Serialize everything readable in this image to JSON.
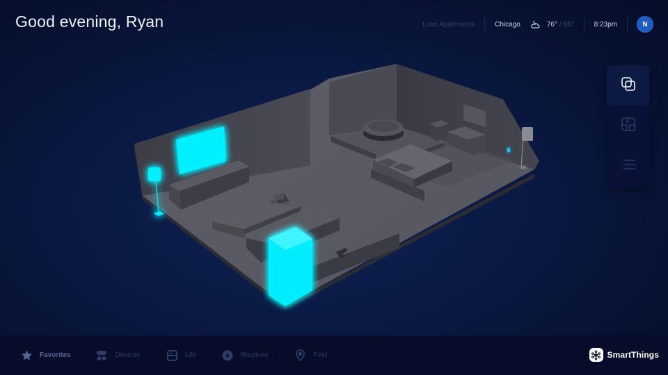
{
  "header": {
    "greeting": "Good evening, Ryan",
    "location": "Luxe Apartments",
    "city": "Chicago",
    "weather_icon": "night-cloud-icon",
    "temp_high": "76°",
    "temp_low": "/ 65°",
    "time": "8:23pm",
    "avatar_initial": "N"
  },
  "view_switcher": {
    "items": [
      {
        "icon": "3d-view-icon",
        "label": "3D view",
        "active": true
      },
      {
        "icon": "floorplan-icon",
        "label": "Floor plan",
        "active": false
      },
      {
        "icon": "list-view-icon",
        "label": "List view",
        "active": false
      }
    ]
  },
  "scene": {
    "rooms": [
      "Living room",
      "Bedroom"
    ],
    "devices_on": [
      "TV",
      "Floor lamp",
      "Air purifier"
    ],
    "devices_standby": [
      "Indicator light"
    ],
    "colors": {
      "glow": "#00f0ff",
      "wall": "#4a4a55",
      "floor": "#5d5d66"
    }
  },
  "bottom_nav": {
    "items": [
      {
        "label": "Favorites",
        "icon": "star-icon",
        "active": true
      },
      {
        "label": "Devices",
        "icon": "devices-icon",
        "active": false
      },
      {
        "label": "Life",
        "icon": "life-icon",
        "active": false
      },
      {
        "label": "Routines",
        "icon": "play-icon",
        "active": false
      },
      {
        "label": "Find",
        "icon": "location-pin-icon",
        "active": false
      }
    ]
  },
  "brand": {
    "name": "SmartThings"
  }
}
